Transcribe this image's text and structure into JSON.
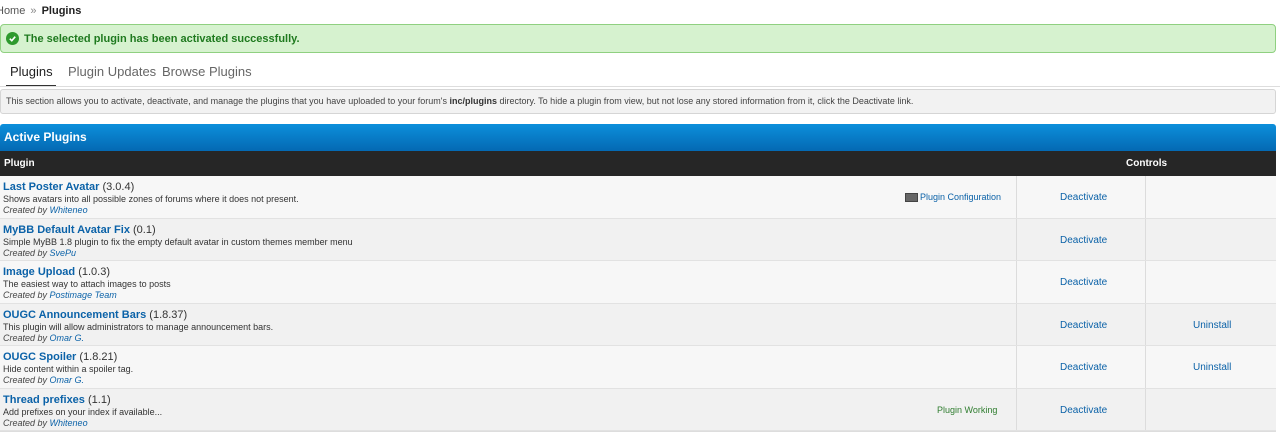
{
  "breadcrumb": {
    "home": "Home",
    "sep": "»",
    "current": "Plugins"
  },
  "alert": {
    "message": "The selected plugin has been activated successfully.",
    "color": "#2e9a2e"
  },
  "tabs": [
    {
      "label": "Plugins",
      "active": true
    },
    {
      "label": "Plugin Updates",
      "active": false
    },
    {
      "label": "Browse Plugins",
      "active": false
    }
  ],
  "description": {
    "before": "This section allows you to activate, deactivate, and manage the plugins that you have uploaded to your forum's ",
    "path": "inc/plugins",
    "after": " directory. To hide a plugin from view, but not lose any stored information from it, click the Deactivate link."
  },
  "panel": {
    "title": "Active Plugins",
    "col_plugin": "Plugin",
    "col_controls": "Controls",
    "color": "#0679c4"
  },
  "plugins": [
    {
      "name": "Last Poster Avatar",
      "version": "(3.0.4)",
      "description": "Shows avatars into all possible zones of forums where it does not present.",
      "created_by": "Created by",
      "author": "Whiteneo",
      "extra": "Plugin Configuration",
      "deactivate": "Deactivate",
      "uninstall": ""
    },
    {
      "name": "MyBB Default Avatar Fix",
      "version": "(0.1)",
      "description": "Simple MyBB 1.8 plugin to fix the empty default avatar in custom themes member menu",
      "created_by": "Created by",
      "author": "SvePu",
      "extra": "",
      "deactivate": "Deactivate",
      "uninstall": ""
    },
    {
      "name": "Image Upload",
      "version": "(1.0.3)",
      "description": "The easiest way to attach images to posts",
      "created_by": "Created by",
      "author": "Postimage Team",
      "extra": "",
      "deactivate": "Deactivate",
      "uninstall": ""
    },
    {
      "name": "OUGC Announcement Bars",
      "version": "(1.8.37)",
      "description": "This plugin will allow administrators to manage announcement bars.",
      "created_by": "Created by",
      "author": "Omar G.",
      "extra": "",
      "deactivate": "Deactivate",
      "uninstall": "Uninstall"
    },
    {
      "name": "OUGC Spoiler",
      "version": "(1.8.21)",
      "description": "Hide content within a spoiler tag.",
      "created_by": "Created by",
      "author": "Omar G.",
      "extra": "",
      "deactivate": "Deactivate",
      "uninstall": "Uninstall"
    },
    {
      "name": "Thread prefixes",
      "version": "(1.1)",
      "description": "Add prefixes on your index if available...",
      "created_by": "Created by",
      "author": "Whiteneo",
      "extra": "Plugin Working",
      "deactivate": "Deactivate",
      "uninstall": ""
    }
  ]
}
